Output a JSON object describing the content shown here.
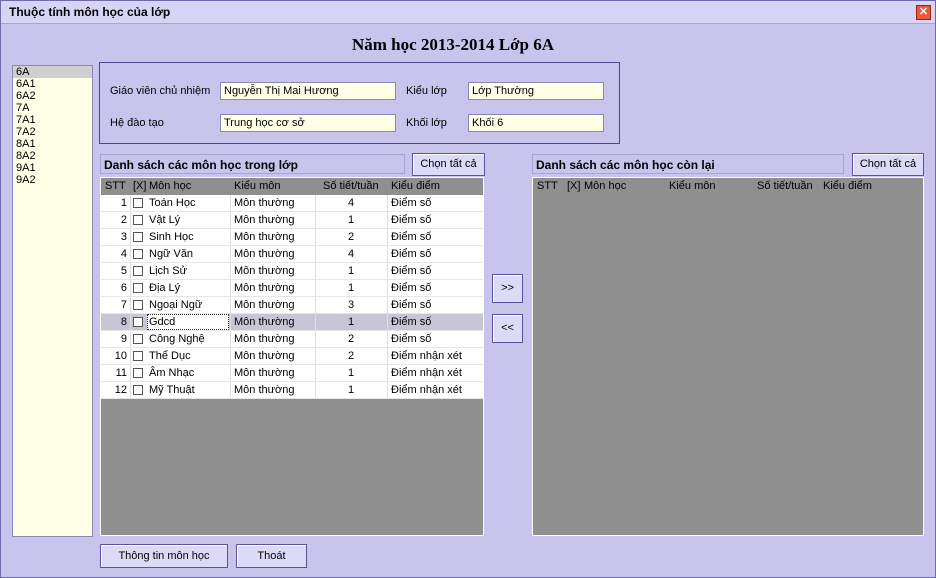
{
  "window": {
    "title": "Thuộc tính môn học của lớp",
    "close_label": "✕"
  },
  "heading": "Năm học 2013-2014 Lớp 6A",
  "class_list": [
    "6A",
    "6A1",
    "6A2",
    "7A",
    "7A1",
    "7A2",
    "8A1",
    "8A2",
    "9A1",
    "9A2"
  ],
  "info": {
    "gvcn_label": "Giáo viên chủ nhiệm",
    "gvcn_value": "Nguyễn Thị Mai Hương",
    "kieu_lop_label": "Kiểu lớp",
    "kieu_lop_value": "Lớp Thường",
    "he_dao_tao_label": "Hệ đào tạo",
    "he_dao_tao_value": "Trung học cơ sở",
    "khoi_lop_label": "Khối lớp",
    "khoi_lop_value": "Khối 6"
  },
  "left_panel": {
    "title": "Danh sách các môn học trong lớp",
    "select_all": "Chọn tất cả",
    "columns": [
      "STT",
      "[X]",
      "Môn học",
      "Kiểu môn",
      "Số tiết/tuần",
      "Kiểu điểm"
    ],
    "rows": [
      {
        "stt": "1",
        "mon": "Toán Học",
        "kieu": "Môn thường",
        "so_tiet": "4",
        "kieu_diem": "Điểm số"
      },
      {
        "stt": "2",
        "mon": "Vật Lý",
        "kieu": "Môn thường",
        "so_tiet": "1",
        "kieu_diem": "Điểm số"
      },
      {
        "stt": "3",
        "mon": "Sinh Học",
        "kieu": "Môn thường",
        "so_tiet": "2",
        "kieu_diem": "Điểm số"
      },
      {
        "stt": "4",
        "mon": "Ngữ Văn",
        "kieu": "Môn thường",
        "so_tiet": "4",
        "kieu_diem": "Điểm số"
      },
      {
        "stt": "5",
        "mon": "Lịch Sử",
        "kieu": "Môn thường",
        "so_tiet": "1",
        "kieu_diem": "Điểm số"
      },
      {
        "stt": "6",
        "mon": "Địa Lý",
        "kieu": "Môn thường",
        "so_tiet": "1",
        "kieu_diem": "Điểm số"
      },
      {
        "stt": "7",
        "mon": "Ngoại Ngữ",
        "kieu": "Môn thường",
        "so_tiet": "3",
        "kieu_diem": "Điểm số"
      },
      {
        "stt": "8",
        "mon": "Gdcd",
        "kieu": "Môn thường",
        "so_tiet": "1",
        "kieu_diem": "Điểm số"
      },
      {
        "stt": "9",
        "mon": "Công Nghệ",
        "kieu": "Môn thường",
        "so_tiet": "2",
        "kieu_diem": "Điểm số"
      },
      {
        "stt": "10",
        "mon": "Thể Dục",
        "kieu": "Môn thường",
        "so_tiet": "2",
        "kieu_diem": "Điểm nhận xét"
      },
      {
        "stt": "11",
        "mon": "Âm Nhạc",
        "kieu": "Môn thường",
        "so_tiet": "1",
        "kieu_diem": "Điểm nhận xét"
      },
      {
        "stt": "12",
        "mon": "Mỹ Thuật",
        "kieu": "Môn thường",
        "so_tiet": "1",
        "kieu_diem": "Điểm nhận xét"
      }
    ]
  },
  "right_panel": {
    "title": "Danh sách các môn học còn lại",
    "select_all": "Chọn tất cả",
    "columns": [
      "STT",
      "[X]",
      "Môn học",
      "Kiểu môn",
      "Số tiết/tuần",
      "Kiểu điểm"
    ]
  },
  "move_right": ">>",
  "move_left": "<<",
  "footer": {
    "info_button": "Thông tin môn học",
    "exit_button": "Thoát"
  }
}
